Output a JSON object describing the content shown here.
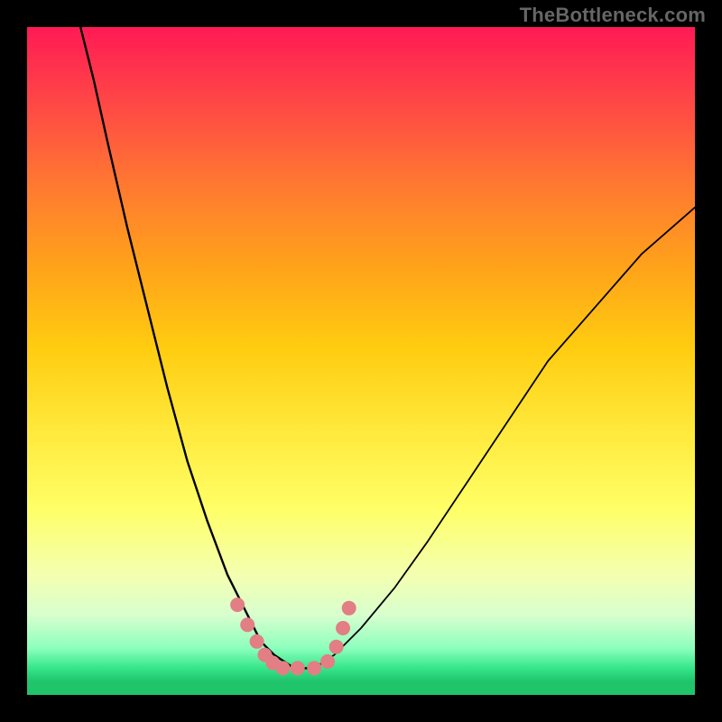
{
  "watermark": "TheBottleneck.com",
  "colors": {
    "frame": "#000000",
    "curve_stroke": "#000000",
    "marker_fill": "#e27e84",
    "gradient_top": "#ff1a55",
    "gradient_bottom": "#1fc46b"
  },
  "chart_data": {
    "type": "line",
    "title": "",
    "xlabel": "",
    "ylabel": "",
    "xlim": [
      0,
      100
    ],
    "ylim": [
      0,
      100
    ],
    "note": "x and y are percentages of the plot area width/height measured from the top-left. Two curves descend to a flat valley ~y=96 around x≈35–45 then the right curve rises toward the upper-right.",
    "series": [
      {
        "name": "left-curve",
        "x": [
          8,
          10,
          12,
          15,
          18,
          21,
          24,
          27,
          30,
          33,
          35,
          37,
          40,
          43
        ],
        "values": [
          0,
          8,
          17,
          30,
          42,
          54,
          65,
          74,
          82,
          88,
          92,
          94,
          96,
          96
        ]
      },
      {
        "name": "right-curve",
        "x": [
          43,
          46,
          50,
          55,
          60,
          66,
          72,
          78,
          85,
          92,
          100
        ],
        "values": [
          96,
          94,
          90,
          84,
          77,
          68,
          59,
          50,
          42,
          34,
          27
        ]
      }
    ],
    "markers": {
      "name": "valley-markers",
      "x": [
        31.5,
        33.0,
        34.4,
        35.6,
        36.8,
        38.3,
        40.5,
        43.0,
        45.0,
        46.3,
        47.3,
        48.2
      ],
      "y": [
        86.5,
        89.5,
        92.0,
        94.0,
        95.2,
        96.0,
        96.0,
        96.0,
        95.0,
        92.8,
        90.0,
        87.0
      ],
      "radius_px": 8
    }
  }
}
